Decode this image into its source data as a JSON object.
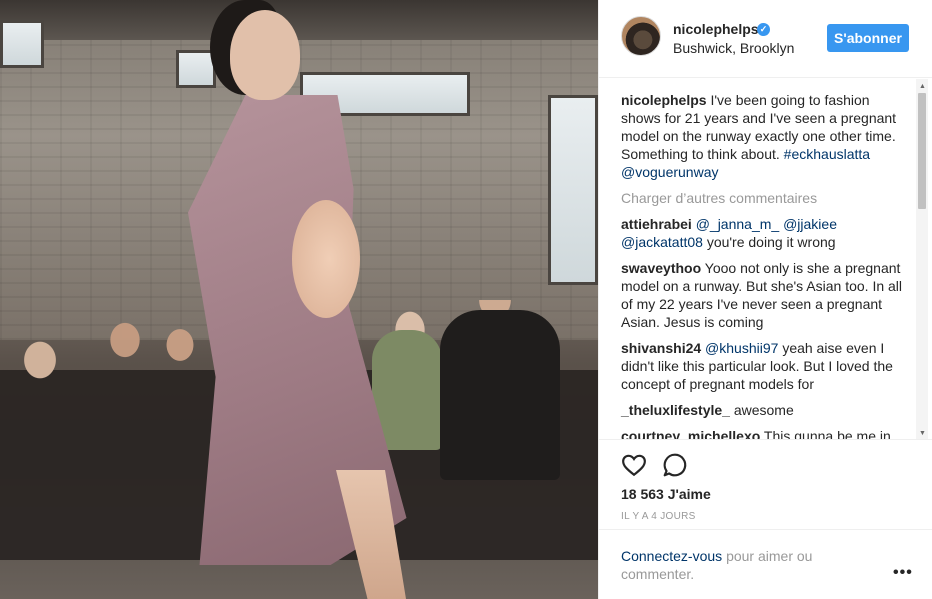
{
  "header": {
    "username": "nicolephelps",
    "verified_icon": "verified-badge-icon",
    "location": "Bushwick, Brooklyn",
    "follow_label": "S'abonner"
  },
  "caption": {
    "username": "nicolephelps",
    "text": "I've been going to fashion shows for 21 years and I've seen a pregnant model on the runway exactly one other time. Something to think about.",
    "hashtag": "#eckhauslatta",
    "mention": "@voguerunway"
  },
  "load_more": "Charger d’autres commentaires",
  "comments": [
    {
      "user": "attiehrabei",
      "mentions": "@_janna_m_ @jjakiee @jackatatt08",
      "text": "you're doing it wrong"
    },
    {
      "user": "swaveythoo",
      "mentions": "",
      "text": "Yooo not only is she a pregnant model on a runway. But she's Asian too. In all of my 22 years I've never seen a pregnant Asian. Jesus is coming"
    },
    {
      "user": "shivanshi24",
      "mentions": "@khushii97",
      "text": "yeah aise even I didn't like this particular look. But I loved the concept of pregnant models for"
    },
    {
      "user": "_theluxlifestyle_",
      "mentions": "",
      "text": "awesome"
    },
    {
      "user": "courtney_michellexo",
      "mentions": "",
      "text": "This gunna be me in"
    }
  ],
  "actions": {
    "like_icon": "heart-icon",
    "comment_icon": "comment-bubble-icon",
    "likes": "18 563 J'aime",
    "time": "IL Y A 4 JOURS"
  },
  "login": {
    "link": "Connectez-vous",
    "text": "pour aimer ou commenter.",
    "more": "•••"
  },
  "colors": {
    "accent": "#3897f0",
    "link": "#003569",
    "muted": "#999999",
    "text": "#262626"
  }
}
